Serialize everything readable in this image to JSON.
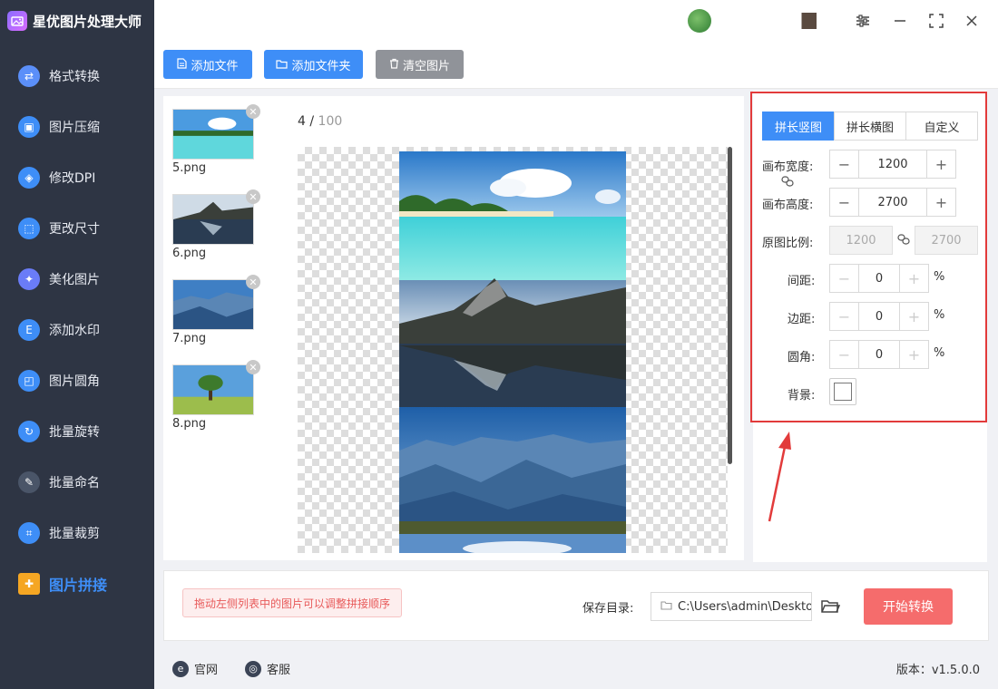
{
  "app": {
    "title": "星优图片处理大师"
  },
  "sidebar": {
    "items": [
      {
        "label": "格式转换",
        "icon": "format-convert-icon",
        "color": "#5b8ff9"
      },
      {
        "label": "图片压缩",
        "icon": "compress-icon",
        "color": "#3e8ef7"
      },
      {
        "label": "修改DPI",
        "icon": "dpi-icon",
        "color": "#3e8ef7"
      },
      {
        "label": "更改尺寸",
        "icon": "resize-icon",
        "color": "#3e8ef7"
      },
      {
        "label": "美化图片",
        "icon": "beautify-icon",
        "color": "#6a7cf7"
      },
      {
        "label": "添加水印",
        "icon": "watermark-icon",
        "color": "#3e8ef7"
      },
      {
        "label": "图片圆角",
        "icon": "round-corner-icon",
        "color": "#3e8ef7"
      },
      {
        "label": "批量旋转",
        "icon": "rotate-icon",
        "color": "#3e8ef7"
      },
      {
        "label": "批量命名",
        "icon": "rename-icon",
        "color": "#4a5568"
      },
      {
        "label": "批量裁剪",
        "icon": "crop-icon",
        "color": "#3e8ef7"
      },
      {
        "label": "图片拼接",
        "icon": "stitch-icon",
        "color": "#f5a623",
        "active": true
      }
    ]
  },
  "toolbar": {
    "add_file": "添加文件",
    "add_folder": "添加文件夹",
    "clear": "清空图片"
  },
  "files": [
    {
      "name": "5.png",
      "scene": "beach"
    },
    {
      "name": "6.png",
      "scene": "lake"
    },
    {
      "name": "7.png",
      "scene": "mountains"
    },
    {
      "name": "8.png",
      "scene": "tree"
    }
  ],
  "preview": {
    "current": "4",
    "separator": " / ",
    "total": "100"
  },
  "settings": {
    "tabs": [
      {
        "label": "拼长竖图",
        "active": true
      },
      {
        "label": "拼长横图",
        "active": false
      },
      {
        "label": "自定义",
        "active": false
      }
    ],
    "canvas_width_label": "画布宽度:",
    "canvas_width": "1200",
    "canvas_height_label": "画布高度:",
    "canvas_height": "2700",
    "ratio_label": "原图比例:",
    "ratio_width": "1200",
    "ratio_height": "2700",
    "spacing_label": "间距:",
    "spacing": "0",
    "margin_label": "边距:",
    "margin": "0",
    "corner_label": "圆角:",
    "corner": "0",
    "percent": "%",
    "bg_label": "背景:",
    "bg_color": "#ffffff"
  },
  "bottom": {
    "hint": "拖动左侧列表中的图片可以调整拼接顺序",
    "save_label": "保存目录:",
    "save_path": "C:\\Users\\admin\\Deskto",
    "start": "开始转换"
  },
  "footer": {
    "website": "官网",
    "support": "客服",
    "version": "版本：v1.5.0.0"
  },
  "colors": {
    "accent": "#3e8ef7",
    "danger": "#f56c6c",
    "highlight_border": "#e23b3b",
    "sidebar_bg": "#2e3544"
  }
}
